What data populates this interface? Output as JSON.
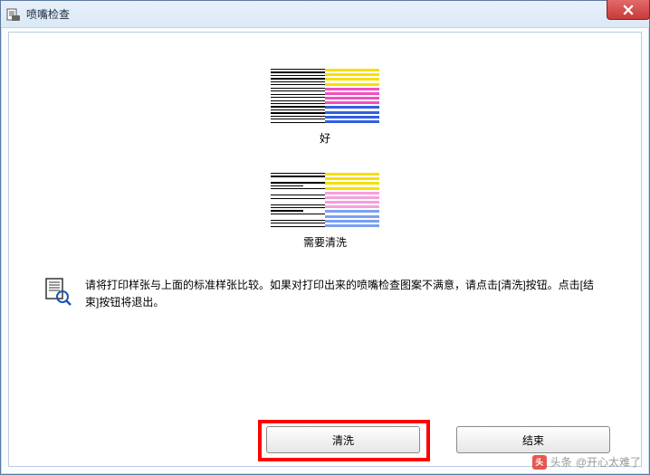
{
  "window": {
    "title": "喷嘴检查"
  },
  "samples": {
    "good_label": "好",
    "bad_label": "需要清洗"
  },
  "instruction_text": "请将打印样张与上面的标准样张比较。如果对打印出来的喷嘴检查图案不满意，请点击[清洗]按钮。点击[结束]按钮将退出。",
  "buttons": {
    "clean": "清洗",
    "finish": "结束"
  },
  "icons": {
    "app": "printer-page-icon",
    "close": "close-icon",
    "instruction": "printer-magnify-icon"
  },
  "watermark": {
    "prefix": "头条",
    "handle": "@开心太难了"
  },
  "highlight": {
    "target": "clean-button"
  }
}
